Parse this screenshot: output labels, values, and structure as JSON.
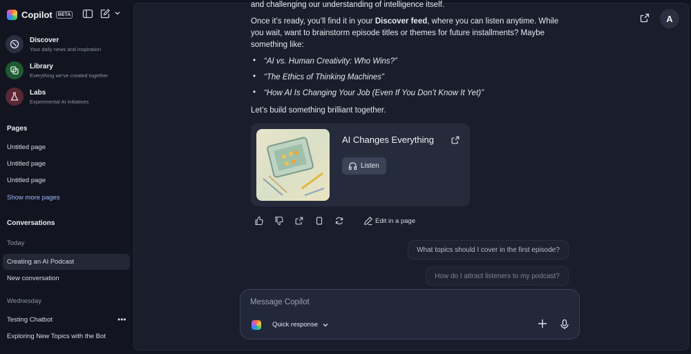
{
  "sidebar": {
    "brand": "Copilot",
    "beta": "BETA",
    "nav": [
      {
        "title": "Discover",
        "subtitle": "Your daily news and inspiration",
        "icon": "compass-icon"
      },
      {
        "title": "Library",
        "subtitle": "Everything we've created together",
        "icon": "library-icon"
      },
      {
        "title": "Labs",
        "subtitle": "Experimental AI initiatives",
        "icon": "flask-icon"
      }
    ],
    "pages_heading": "Pages",
    "pages": [
      "Untitled page",
      "Untitled page",
      "Untitled page"
    ],
    "show_more": "Show more pages",
    "conversations_heading": "Conversations",
    "today_label": "Today",
    "today_items": [
      "Creating an AI Podcast",
      "New conversation"
    ],
    "wednesday_label": "Wednesday",
    "wednesday_items": [
      "Testing Chatbot",
      "Exploring New Topics with the Bot"
    ]
  },
  "header": {
    "avatar_letter": "A"
  },
  "message": {
    "line_top": "and challenging our understanding of intelligence itself.",
    "p1_before": "Once it’s ready, you’ll find it in your ",
    "p1_bold": "Discover feed",
    "p1_after": ", where you can listen anytime. While",
    "p1_line2": "you wait, want to brainstorm episode titles or themes for future installments? Maybe",
    "p1_line3": "something like:",
    "bullets": [
      "“AI vs. Human Creativity: Who Wins?”",
      "“The Ethics of Thinking Machines”",
      "“How AI Is Changing Your Job (Even If You Don’t Know It Yet)”"
    ],
    "closing": "Let’s build something brilliant together."
  },
  "card": {
    "title": "AI Changes Everything",
    "listen": "Listen"
  },
  "actions": {
    "edit": "Edit in a page"
  },
  "suggestions": [
    "What topics should I cover in the first episode?",
    "How do I attract listeners to my podcast?"
  ],
  "composer": {
    "placeholder": "Message Copilot",
    "mode": "Quick response"
  }
}
